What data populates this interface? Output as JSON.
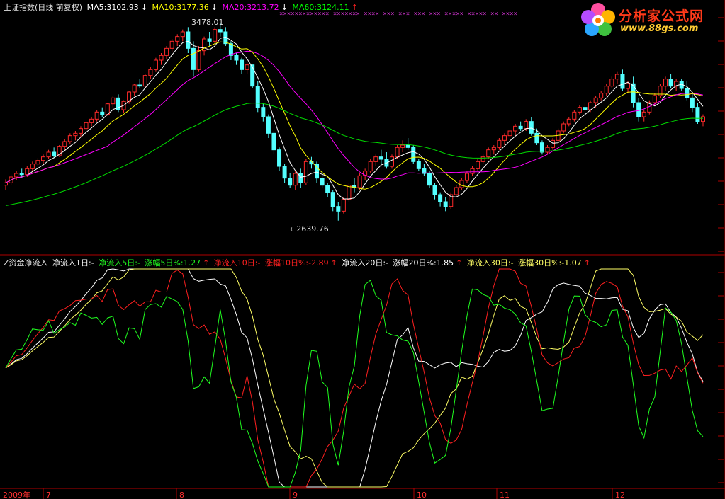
{
  "legend_top": {
    "index_name": "上证指数(日线 前复权)",
    "ma5": "MA5:3102.93",
    "ma10": "MA10:3177.36",
    "ma20": "MA20:3213.72",
    "ma60": "MA60:3124.11",
    "colors": {
      "index": "#e0e0e0",
      "ma5": "#ffffff",
      "ma10": "#ffff00",
      "ma20": "#ff00ff",
      "ma60": "#00ff00"
    }
  },
  "legend_bottom": {
    "name": "Z资金净流入",
    "in1": "净流入1日:-",
    "in5": "净流入5日:-",
    "chg5": "涨幅5日%:1.27",
    "in10": "净流入10日:-",
    "chg10": "涨幅10日%:-2.89",
    "in20": "净流入20日:-",
    "chg20": "涨幅20日%:1.85",
    "in30": "净流入30日:-",
    "chg30": "涨幅30日%:-1.07"
  },
  "logo": {
    "title": "分析家公式网",
    "url": "www.88gs.com"
  },
  "annotations": {
    "high": "3478.01",
    "low": "←2639.76"
  },
  "x_axis": {
    "year_label": "2009年",
    "months": [
      "7",
      "8",
      "9",
      "10",
      "11",
      "12"
    ]
  },
  "chart_data": [
    {
      "type": "candlestick",
      "title": "上证指数(日线 前复权)",
      "ylim": [
        2600,
        3500
      ],
      "series_names": [
        "MA5",
        "MA10",
        "MA20",
        "MA60"
      ],
      "up_color": "#ff2a2a",
      "down_color": "#53ffff",
      "ohlc": [
        [
          2790,
          2815,
          2770,
          2800
        ],
        [
          2800,
          2835,
          2790,
          2825
        ],
        [
          2825,
          2850,
          2810,
          2840
        ],
        [
          2840,
          2860,
          2820,
          2835
        ],
        [
          2835,
          2870,
          2825,
          2860
        ],
        [
          2860,
          2890,
          2845,
          2880
        ],
        [
          2880,
          2905,
          2870,
          2895
        ],
        [
          2895,
          2920,
          2880,
          2910
        ],
        [
          2910,
          2940,
          2900,
          2930
        ],
        [
          2930,
          2950,
          2905,
          2915
        ],
        [
          2915,
          2960,
          2910,
          2955
        ],
        [
          2955,
          2985,
          2940,
          2975
        ],
        [
          2975,
          3010,
          2965,
          3000
        ],
        [
          3000,
          3020,
          2980,
          3010
        ],
        [
          3010,
          3040,
          2995,
          3030
        ],
        [
          3030,
          3060,
          3020,
          3055
        ],
        [
          3055,
          3080,
          3040,
          3070
        ],
        [
          3070,
          3110,
          3060,
          3100
        ],
        [
          3100,
          3120,
          3080,
          3090
        ],
        [
          3090,
          3140,
          3085,
          3135
        ],
        [
          3135,
          3170,
          3120,
          3160
        ],
        [
          3160,
          3175,
          3100,
          3110
        ],
        [
          3110,
          3150,
          3095,
          3145
        ],
        [
          3145,
          3190,
          3135,
          3185
        ],
        [
          3185,
          3220,
          3170,
          3215
        ],
        [
          3215,
          3240,
          3200,
          3210
        ],
        [
          3210,
          3260,
          3200,
          3255
        ],
        [
          3255,
          3290,
          3240,
          3280
        ],
        [
          3280,
          3330,
          3270,
          3320
        ],
        [
          3320,
          3350,
          3300,
          3340
        ],
        [
          3340,
          3380,
          3325,
          3370
        ],
        [
          3370,
          3410,
          3355,
          3400
        ],
        [
          3400,
          3430,
          3380,
          3420
        ],
        [
          3420,
          3450,
          3400,
          3440
        ],
        [
          3440,
          3460,
          3350,
          3370
        ],
        [
          3370,
          3400,
          3250,
          3280
        ],
        [
          3280,
          3380,
          3270,
          3360
        ],
        [
          3360,
          3420,
          3340,
          3410
        ],
        [
          3410,
          3440,
          3380,
          3400
        ],
        [
          3400,
          3460,
          3390,
          3450
        ],
        [
          3450,
          3478,
          3420,
          3440
        ],
        [
          3440,
          3460,
          3380,
          3390
        ],
        [
          3390,
          3400,
          3320,
          3340
        ],
        [
          3340,
          3350,
          3300,
          3320
        ],
        [
          3320,
          3330,
          3260,
          3280
        ],
        [
          3280,
          3310,
          3260,
          3300
        ],
        [
          3300,
          3300,
          3200,
          3210
        ],
        [
          3210,
          3230,
          3100,
          3120
        ],
        [
          3120,
          3140,
          3060,
          3080
        ],
        [
          3080,
          3090,
          2990,
          3010
        ],
        [
          3010,
          3020,
          2920,
          2940
        ],
        [
          2940,
          2950,
          2850,
          2870
        ],
        [
          2870,
          2880,
          2800,
          2820
        ],
        [
          2820,
          2840,
          2780,
          2790
        ],
        [
          2790,
          2850,
          2770,
          2840
        ],
        [
          2840,
          2860,
          2780,
          2800
        ],
        [
          2800,
          2900,
          2790,
          2890
        ],
        [
          2890,
          2910,
          2860,
          2880
        ],
        [
          2880,
          2890,
          2800,
          2820
        ],
        [
          2820,
          2850,
          2780,
          2790
        ],
        [
          2790,
          2800,
          2740,
          2760
        ],
        [
          2760,
          2770,
          2680,
          2700
        ],
        [
          2700,
          2720,
          2639.76,
          2680
        ],
        [
          2680,
          2740,
          2670,
          2730
        ],
        [
          2730,
          2800,
          2720,
          2790
        ],
        [
          2790,
          2820,
          2760,
          2780
        ],
        [
          2780,
          2840,
          2770,
          2830
        ],
        [
          2830,
          2860,
          2810,
          2850
        ],
        [
          2850,
          2900,
          2840,
          2890
        ],
        [
          2890,
          2920,
          2870,
          2910
        ],
        [
          2910,
          2940,
          2880,
          2900
        ],
        [
          2900,
          2930,
          2860,
          2870
        ],
        [
          2870,
          2920,
          2860,
          2910
        ],
        [
          2910,
          2960,
          2900,
          2950
        ],
        [
          2950,
          2980,
          2930,
          2960
        ],
        [
          2960,
          2990,
          2940,
          2950
        ],
        [
          2950,
          2960,
          2880,
          2890
        ],
        [
          2890,
          2900,
          2850,
          2860
        ],
        [
          2860,
          2880,
          2830,
          2840
        ],
        [
          2840,
          2850,
          2780,
          2790
        ],
        [
          2790,
          2800,
          2730,
          2750
        ],
        [
          2750,
          2760,
          2700,
          2720
        ],
        [
          2720,
          2740,
          2680,
          2700
        ],
        [
          2700,
          2760,
          2690,
          2750
        ],
        [
          2750,
          2790,
          2740,
          2780
        ],
        [
          2780,
          2820,
          2770,
          2810
        ],
        [
          2810,
          2850,
          2800,
          2840
        ],
        [
          2840,
          2870,
          2830,
          2860
        ],
        [
          2860,
          2900,
          2850,
          2890
        ],
        [
          2890,
          2920,
          2880,
          2910
        ],
        [
          2910,
          2950,
          2900,
          2940
        ],
        [
          2940,
          2960,
          2920,
          2950
        ],
        [
          2950,
          2990,
          2940,
          2980
        ],
        [
          2980,
          3010,
          2960,
          3000
        ],
        [
          3000,
          3030,
          2990,
          3020
        ],
        [
          3020,
          3050,
          3000,
          3040
        ],
        [
          3040,
          3060,
          3020,
          3030
        ],
        [
          3030,
          3070,
          3020,
          3060
        ],
        [
          3060,
          3080,
          3000,
          3010
        ],
        [
          3010,
          3030,
          2960,
          2970
        ],
        [
          2970,
          2980,
          2920,
          2930
        ],
        [
          2930,
          2960,
          2920,
          2950
        ],
        [
          2950,
          2990,
          2940,
          2980
        ],
        [
          2980,
          3030,
          2970,
          3020
        ],
        [
          3020,
          3060,
          3010,
          3050
        ],
        [
          3050,
          3080,
          3040,
          3070
        ],
        [
          3070,
          3110,
          3060,
          3100
        ],
        [
          3100,
          3130,
          3090,
          3120
        ],
        [
          3120,
          3140,
          3100,
          3110
        ],
        [
          3110,
          3150,
          3100,
          3140
        ],
        [
          3140,
          3170,
          3120,
          3160
        ],
        [
          3160,
          3190,
          3150,
          3180
        ],
        [
          3180,
          3220,
          3170,
          3210
        ],
        [
          3210,
          3250,
          3200,
          3240
        ],
        [
          3240,
          3270,
          3220,
          3260
        ],
        [
          3260,
          3280,
          3190,
          3200
        ],
        [
          3200,
          3230,
          3180,
          3220
        ],
        [
          3220,
          3250,
          3120,
          3140
        ],
        [
          3140,
          3160,
          3060,
          3080
        ],
        [
          3080,
          3110,
          3060,
          3100
        ],
        [
          3100,
          3150,
          3090,
          3140
        ],
        [
          3140,
          3180,
          3130,
          3170
        ],
        [
          3170,
          3220,
          3160,
          3210
        ],
        [
          3210,
          3250,
          3190,
          3240
        ],
        [
          3240,
          3260,
          3200,
          3210
        ],
        [
          3210,
          3240,
          3190,
          3230
        ],
        [
          3230,
          3240,
          3190,
          3200
        ],
        [
          3200,
          3230,
          3150,
          3160
        ],
        [
          3160,
          3180,
          3100,
          3120
        ],
        [
          3120,
          3140,
          3050,
          3060
        ],
        [
          3060,
          3090,
          3040,
          3080
        ]
      ]
    },
    {
      "type": "line",
      "title": "Z资金净流入",
      "series": [
        {
          "name": "净流入20日",
          "color": "#ffffff"
        },
        {
          "name": "净流入30日",
          "color": "#ffff66"
        },
        {
          "name": "净流入10日",
          "color": "#ff2020"
        },
        {
          "name": "净流入5日",
          "color": "#20ff20"
        }
      ]
    }
  ]
}
